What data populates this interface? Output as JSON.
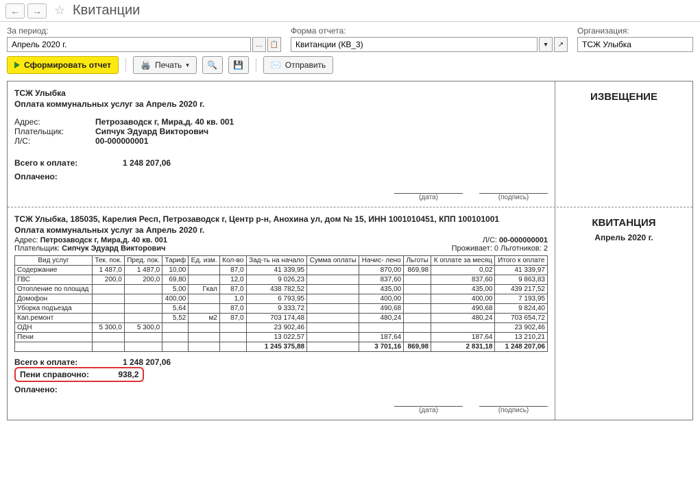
{
  "header": {
    "title": "Квитанции"
  },
  "filters": {
    "period_label": "За период:",
    "period_value": "Апрель 2020 г.",
    "form_label": "Форма отчета:",
    "form_value": "Квитанции (КВ_3)",
    "org_label": "Организация:",
    "org_value": "ТСЖ Улыбка"
  },
  "toolbar": {
    "generate": "Сформировать отчет",
    "print": "Печать",
    "send": "Отправить"
  },
  "notice": {
    "right_title": "ИЗВЕЩЕНИЕ",
    "org": "ТСЖ Улыбка",
    "headline": "Оплата коммунальных услуг за Апрель 2020 г.",
    "addr_label": "Адрес:",
    "addr_value": "Петрозаводск г, Мира,д. 40 кв. 001",
    "payer_label": "Плательщик:",
    "payer_value": "Сипчук Эдуард Викторович",
    "account_label": "Л/С:",
    "account_value": "00-000000001",
    "total_label": "Всего к оплате:",
    "total_value": "1 248 207,06",
    "paid_label": "Оплачено:",
    "date_label": "(дата)",
    "sign_label": "(подпись)"
  },
  "receipt": {
    "right_title": "КВИТАНЦИЯ",
    "right_sub": "Апрель 2020 г.",
    "org_full": "ТСЖ Улыбка, 185035, Карелия Респ, Петрозаводск г, Центр р-н, Анохина ул, дом № 15, ИНН 1001010451, КПП 100101001",
    "headline": "Оплата коммунальных услуг за Апрель 2020 г.",
    "addr_label": "Адрес:",
    "addr_value": "Петрозаводск г, Мира,д. 40 кв. 001",
    "account_label": "Л/С:",
    "account_value": "00-000000001",
    "payer_label": "Плательщик:",
    "payer_value": "Сипчук Эдуард Викторович",
    "residents": "Проживает: 0 Льготников: 2",
    "total_label": "Всего к оплате:",
    "total_value": "1 248 207,06",
    "peni_label": "Пени справочно:",
    "peni_value": "938,2",
    "paid_label": "Оплачено:",
    "date_label": "(дата)",
    "sign_label": "(подпись)"
  },
  "table": {
    "headers": [
      "Вид услуг",
      "Тек. пок.",
      "Пред. пок.",
      "Тариф",
      "Ед. изм.",
      "Кол-во",
      "Зад-ть на начало",
      "Сумма оплаты",
      "Начис- лено",
      "Льготы",
      "К оплате за месяц",
      "Итого к оплате"
    ],
    "rows": [
      {
        "name": "Содержание",
        "cur": "1 487,0",
        "prev": "1 487,0",
        "tar": "10,00",
        "unit": "",
        "qty": "87,0",
        "debt": "41 339,95",
        "paid": "",
        "acc": "870,00",
        "lg": "869,98",
        "month": "0,02",
        "total": "41 339,97"
      },
      {
        "name": "ГВС",
        "cur": "200,0",
        "prev": "200,0",
        "tar": "69,80",
        "unit": "",
        "qty": "12,0",
        "debt": "9 026,23",
        "paid": "",
        "acc": "837,60",
        "lg": "",
        "month": "837,60",
        "total": "9 863,83"
      },
      {
        "name": "Отопление по площад",
        "cur": "",
        "prev": "",
        "tar": "5,00",
        "unit": "Гкал",
        "qty": "87,0",
        "debt": "438 782,52",
        "paid": "",
        "acc": "435,00",
        "lg": "",
        "month": "435,00",
        "total": "439 217,52"
      },
      {
        "name": "Домофон",
        "cur": "",
        "prev": "",
        "tar": "400,00",
        "unit": "",
        "qty": "1,0",
        "debt": "6 793,95",
        "paid": "",
        "acc": "400,00",
        "lg": "",
        "month": "400,00",
        "total": "7 193,95"
      },
      {
        "name": "Уборка подъезда",
        "cur": "",
        "prev": "",
        "tar": "5,64",
        "unit": "",
        "qty": "87,0",
        "debt": "9 333,72",
        "paid": "",
        "acc": "490,68",
        "lg": "",
        "month": "490,68",
        "total": "9 824,40"
      },
      {
        "name": "Кап.ремонт",
        "cur": "",
        "prev": "",
        "tar": "5,52",
        "unit": "м2",
        "qty": "87,0",
        "debt": "703 174,48",
        "paid": "",
        "acc": "480,24",
        "lg": "",
        "month": "480,24",
        "total": "703 654,72"
      },
      {
        "name": "ОДН",
        "cur": "5 300,0",
        "prev": "5 300,0",
        "tar": "",
        "unit": "",
        "qty": "",
        "debt": "23 902,46",
        "paid": "",
        "acc": "",
        "lg": "",
        "month": "",
        "total": "23 902,46"
      },
      {
        "name": "Пени",
        "cur": "",
        "prev": "",
        "tar": "",
        "unit": "",
        "qty": "",
        "debt": "13 022,57",
        "paid": "",
        "acc": "187,64",
        "lg": "",
        "month": "187,64",
        "total": "13 210,21"
      }
    ],
    "totals": {
      "debt": "1 245 375,88",
      "paid": "",
      "acc": "3 701,16",
      "lg": "869,98",
      "month": "2 831,18",
      "total": "1 248 207,06"
    }
  }
}
